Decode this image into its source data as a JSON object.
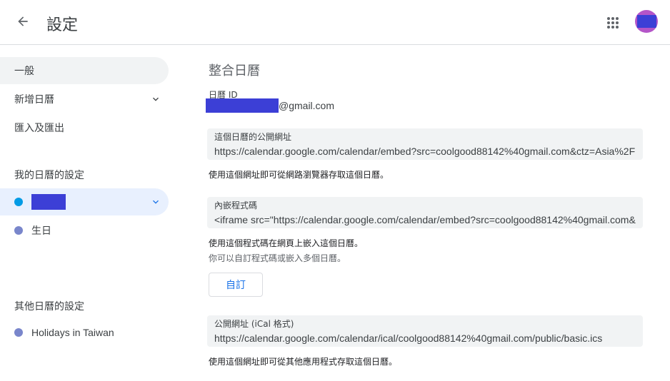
{
  "header": {
    "title": "設定",
    "back_icon": "arrow-back-icon",
    "apps_icon": "apps-grid-icon"
  },
  "sidebar": {
    "general": "一般",
    "add_calendar": "新增日曆",
    "import_export": "匯入及匯出",
    "my_calendars_label": "我的日曆的設定",
    "my_calendars": [
      {
        "label": "",
        "color": "#039be5",
        "redacted": true
      },
      {
        "label": "生日",
        "color": "#7986cb"
      }
    ],
    "other_calendars_label": "其他日曆的設定",
    "other_calendars": [
      {
        "label": "Holidays in Taiwan",
        "color": "#7986cb"
      }
    ]
  },
  "main": {
    "section_title": "整合日曆",
    "calendar_id_label": "日曆 ID",
    "calendar_id_suffix": "@gmail.com",
    "public_url": {
      "label": "這個日曆的公開網址",
      "value": "https://calendar.google.com/calendar/embed?src=coolgood88142%40gmail.com&ctz=Asia%2F",
      "helper": "使用這個網址即可從網路瀏覽器存取這個日曆。"
    },
    "embed_code": {
      "label": "內嵌程式碼",
      "value": "<iframe src=\"https://calendar.google.com/calendar/embed?src=coolgood88142%40gmail.com&",
      "helper": "使用這個程式碼在網頁上嵌入這個日曆。",
      "helper2": "你可以自訂程式碼或嵌入多個日曆。",
      "customize_label": "自訂"
    },
    "ical_url": {
      "label": "公開網址 (iCal 格式)",
      "value": "https://calendar.google.com/calendar/ical/coolgood88142%40gmail.com/public/basic.ics",
      "helper": "使用這個網址即可從其他應用程式存取這個日曆。"
    }
  },
  "colors": {
    "accent": "#1a73e8",
    "selected_bg": "#e8f0fe",
    "field_bg": "#f1f3f4"
  }
}
